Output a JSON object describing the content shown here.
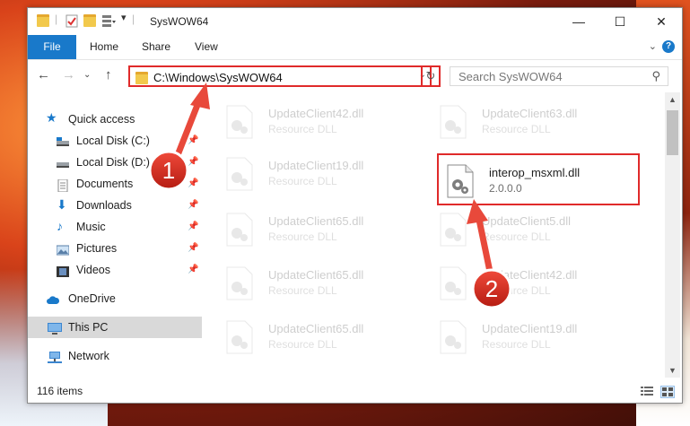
{
  "window": {
    "title": "SysWOW64",
    "minimize": "—",
    "maximize": "☐",
    "close": "✕"
  },
  "ribbon": {
    "file": "File",
    "home": "Home",
    "share": "Share",
    "view": "View",
    "help": "?"
  },
  "address": {
    "path": "C:\\Windows\\SysWOW64",
    "search_placeholder": "Search SysWOW64"
  },
  "nav": {
    "quick_access": "Quick access",
    "local_c": "Local Disk (C:)",
    "local_d": "Local Disk (D:)",
    "documents": "Documents",
    "downloads": "Downloads",
    "music": "Music",
    "pictures": "Pictures",
    "videos": "Videos",
    "onedrive": "OneDrive",
    "this_pc": "This PC",
    "network": "Network"
  },
  "files": [
    {
      "name": "UpdateClient42.dll",
      "sub": "Resource DLL"
    },
    {
      "name": "UpdateClient63.dll",
      "sub": "Resource DLL"
    },
    {
      "name": "UpdateClient19.dll",
      "sub": "Resource DLL"
    },
    {
      "name": "interop_msxml.dll",
      "sub": "2.0.0.0"
    },
    {
      "name": "UpdateClient65.dll",
      "sub": "Resource DLL"
    },
    {
      "name": "UpdateClient5.dll",
      "sub": "Resource DLL"
    },
    {
      "name": "UpdateClient65.dll",
      "sub": "Resource DLL"
    },
    {
      "name": "UpdateClient42.dll",
      "sub": "Resource DLL"
    },
    {
      "name": "UpdateClient65.dll",
      "sub": "Resource DLL"
    },
    {
      "name": "UpdateClient19.dll",
      "sub": "Resource DLL"
    }
  ],
  "status": {
    "items": "116 items"
  },
  "annotations": {
    "step1": "1",
    "step2": "2"
  },
  "colors": {
    "accent": "#1979ca",
    "annotation": "#e02a2a"
  }
}
